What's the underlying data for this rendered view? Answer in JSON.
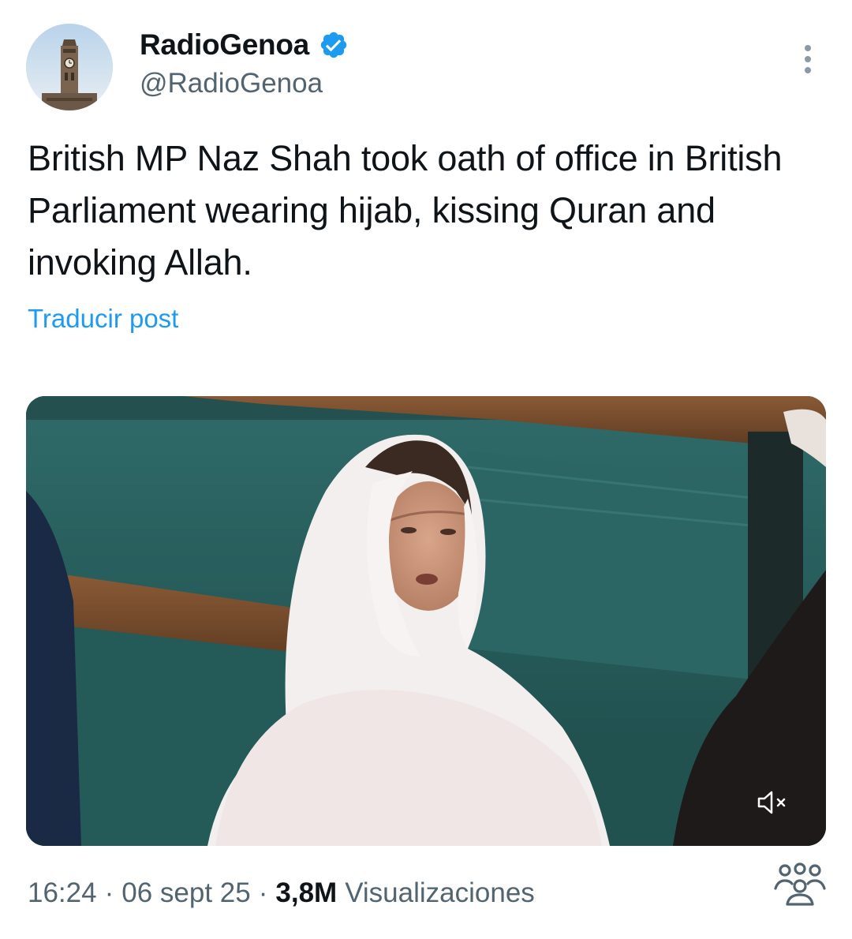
{
  "author": {
    "display_name": "RadioGenoa",
    "handle": "@RadioGenoa",
    "verified": true,
    "avatar_icon": "clock-tower-avatar"
  },
  "tweet": {
    "text": "British MP Naz Shah took oath of office in British Parliament wearing hijab, kissing Quran and invoking Allah.",
    "translate_label": "Traducir post"
  },
  "media": {
    "type": "video",
    "muted": true,
    "mute_icon": "speaker-muted-icon"
  },
  "meta": {
    "time": "16:24",
    "separator": "·",
    "date": "06 sept 25",
    "views_count": "3,8M",
    "views_label": "Visualizaciones"
  },
  "colors": {
    "accent": "#1d9bf0",
    "text_primary": "#0f1419",
    "text_secondary": "#536471"
  }
}
